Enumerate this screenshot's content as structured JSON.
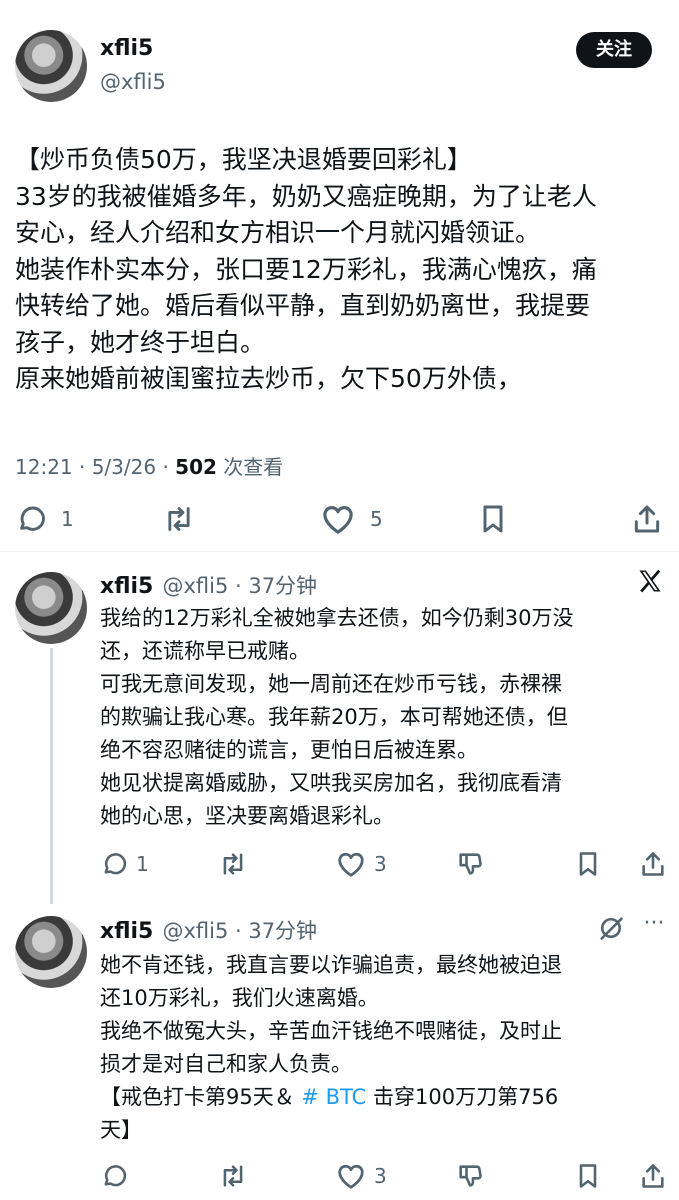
{
  "main_post": {
    "author_name": "xfli5",
    "author_handle": "@xfli5",
    "follow_label": "关注",
    "text_lines": [
      "【炒币负债50万，我坚决退婚要回彩礼】",
      "33岁的我被催婚多年，奶奶又癌症晚期，为了让老人",
      "安心，经人介绍和女方相识一个月就闪婚领证。",
      "她装作朴实本分，张口要12万彩礼，我满心愧疚，痛",
      "快转给了她。婚后看似平静，直到奶奶离世，我提要",
      "孩子，她才终于坦白。",
      "原来她婚前被闺蜜拉去炒币，欠下50万外债，"
    ],
    "timestamp": "12:21 · 5/3/26 · ",
    "views_count": "502",
    "views_label": " 次查看",
    "reply_count": "1",
    "like_count": "5"
  },
  "reply_1": {
    "author_name": "xfli5",
    "author_meta": "@xfli5 · 37分钟",
    "text_lines": [
      "我给的12万彩礼全被她拿去还债，如今仍剩30万没",
      "还，还谎称早已戒赌。",
      "可我无意间发现，她一周前还在炒币亏钱，赤裸裸",
      "的欺骗让我心寒。我年薪20万，本可帮她还债，但",
      "绝不容忍赌徒的谎言，更怕日后被连累。",
      "她见状提离婚威胁，又哄我买房加名，我彻底看清",
      "她的心思，坚决要离婚退彩礼。"
    ],
    "reply_count": "1",
    "like_count": "3"
  },
  "reply_2": {
    "author_name": "xfli5",
    "author_meta": "@xfli5 · 37分钟",
    "text_lines": [
      "她不肯还钱，我直言要以诈骗追责，最终她被迫退",
      "还10万彩礼，我们火速离婚。",
      "我绝不做冤大头，辛苦血汗钱绝不喂赌徒，及时止",
      "损才是对自己和家人负责。"
    ],
    "tag_line_prefix": "【戒色打卡第95天＆ ",
    "tag_line_hashtag": "# BTC",
    "tag_line_suffix": " 击穿100万刀第756",
    "tag_line_end": "天】",
    "like_count": "3"
  },
  "colors": {
    "link": "#1d9bf0",
    "text": "#0f1419",
    "muted": "#536471"
  },
  "icons": [
    "reply-icon",
    "retweet-icon",
    "like-icon",
    "bookmark-icon",
    "share-icon",
    "x-logo-icon",
    "dislike-icon",
    "grok-icon"
  ]
}
